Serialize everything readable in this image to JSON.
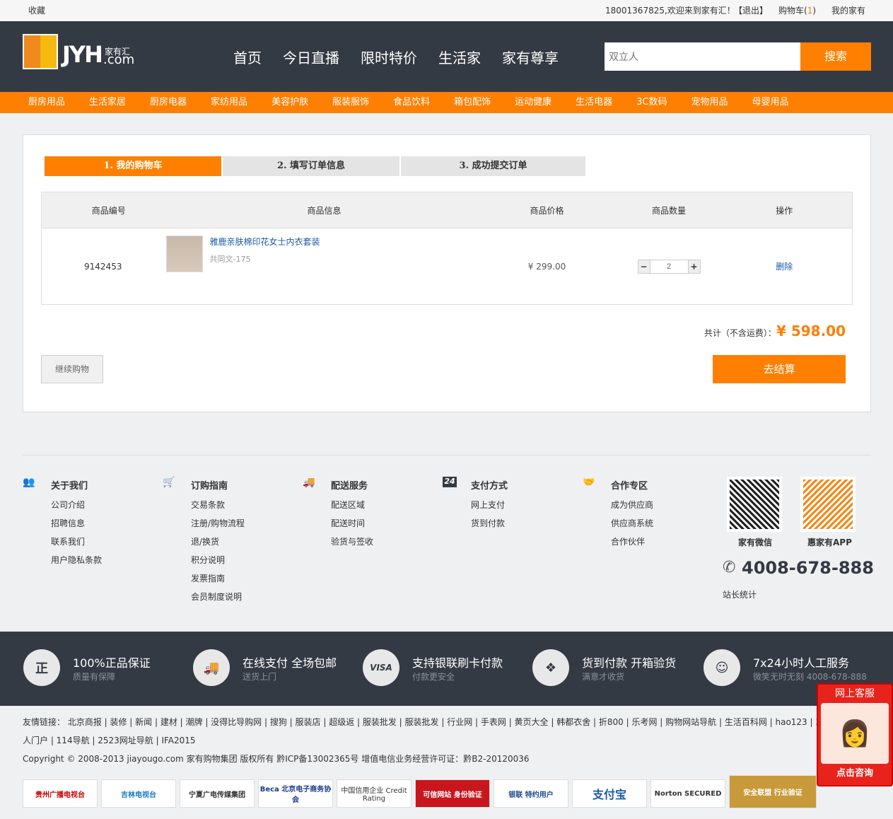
{
  "topbar": {
    "favorite": "收藏",
    "welcome": "18001367825,欢迎来到家有汇！",
    "logout": "【退出】",
    "cart_label": "购物车(",
    "cart_count": "1",
    "cart_close": ")",
    "my": "我的家有"
  },
  "header": {
    "logo_text": "JYH",
    "logo_sub": "家有汇",
    "logo_domain": ".com",
    "nav": [
      "首页",
      "今日直播",
      "限时特价",
      "生活家",
      "家有尊享"
    ],
    "search_placeholder": "双立人",
    "search_button": "搜索"
  },
  "categories": [
    "厨房用品",
    "生活家居",
    "厨房电器",
    "家纺用品",
    "美容护肤",
    "服装服饰",
    "食品饮料",
    "箱包配饰",
    "运动健康",
    "生活电器",
    "3C数码",
    "宠物用品",
    "母婴用品"
  ],
  "steps": [
    "1. 我的购物车",
    "2. 填写订单信息",
    "3. 成功提交订单"
  ],
  "cart": {
    "headers": [
      "商品编号",
      "商品信息",
      "商品价格",
      "商品数量",
      "操作"
    ],
    "items": [
      {
        "id": "9142453",
        "name": "雅鹿亲肤棉印花女士内衣套装",
        "spec": "共同文-175",
        "price": "¥ 299.00",
        "qty": "2",
        "action": "删除"
      }
    ],
    "total_label": "共计（不含运费）：",
    "total": "¥ 598.00",
    "continue": "继续购物",
    "checkout": "去结算"
  },
  "footer": {
    "columns": [
      {
        "title": "关于我们",
        "links": [
          "公司介绍",
          "招聘信息",
          "联系我们",
          "用户隐私条款"
        ]
      },
      {
        "title": "订购指南",
        "links": [
          "交易条款",
          "注册/购物流程",
          "退/换货",
          "积分说明",
          "发票指南",
          "会员制度说明"
        ]
      },
      {
        "title": "配送服务",
        "links": [
          "配送区域",
          "配送时间",
          "验货与签收"
        ]
      },
      {
        "title": "支付方式",
        "links": [
          "网上支付",
          "货到付款"
        ]
      },
      {
        "title": "合作专区",
        "links": [
          "成为供应商",
          "供应商系统",
          "合作伙伴"
        ]
      }
    ],
    "qr": [
      "家有微信",
      "惠家有APP"
    ],
    "phone": "4008-678-888",
    "stats": "站长统计"
  },
  "services": [
    {
      "icon": "正",
      "title": "100%正品保证",
      "sub": "质量有保障"
    },
    {
      "icon": "🚚",
      "title": "在线支付 全场包邮",
      "sub": "送货上门"
    },
    {
      "icon": "VISA",
      "title": "支持银联刷卡付款",
      "sub": "付款更安全"
    },
    {
      "icon": "❖",
      "title": "货到付款 开箱验货",
      "sub": "满意才收货"
    },
    {
      "icon": "☺",
      "title": "7x24小时人工服务",
      "sub": "微笑无时无刻 4008-678-888"
    }
  ],
  "links": {
    "line1": "友情链接： 北京商报 | 装修 | 新闻 | 建材 | 潮牌 | 没得比导购网 | 搜狗 | 服装店 | 超级返 | 服装批发 | 服装批发 | 行业网 | 手表网 | 黄页大全 | 韩都衣舍 | 折800 | 乐考网 | 购物网站导航 | 生活百科网 | hao123 | 360",
    "line2": "人门户 | 114导航 | 2523网址导航 | IFA2015",
    "copyright": "Copyright © 2008-2013 jiayougo.com 家有购物集团 版权所有 黔ICP备13002365号 增值电信业务经营许可证：黔B2-20120036"
  },
  "badges": [
    "贵州广播电视台",
    "吉林电视台",
    "宁夏广电传媒集团",
    "Beca 北京电子商务协会",
    "中国信用企业 Credit Rating",
    "可信网站 身份验证",
    "银联 特约用户",
    "支付宝",
    "Norton SECURED",
    "安全联盟 行业验证"
  ],
  "kefu": {
    "title": "网上客服",
    "button": "点击咨询"
  }
}
